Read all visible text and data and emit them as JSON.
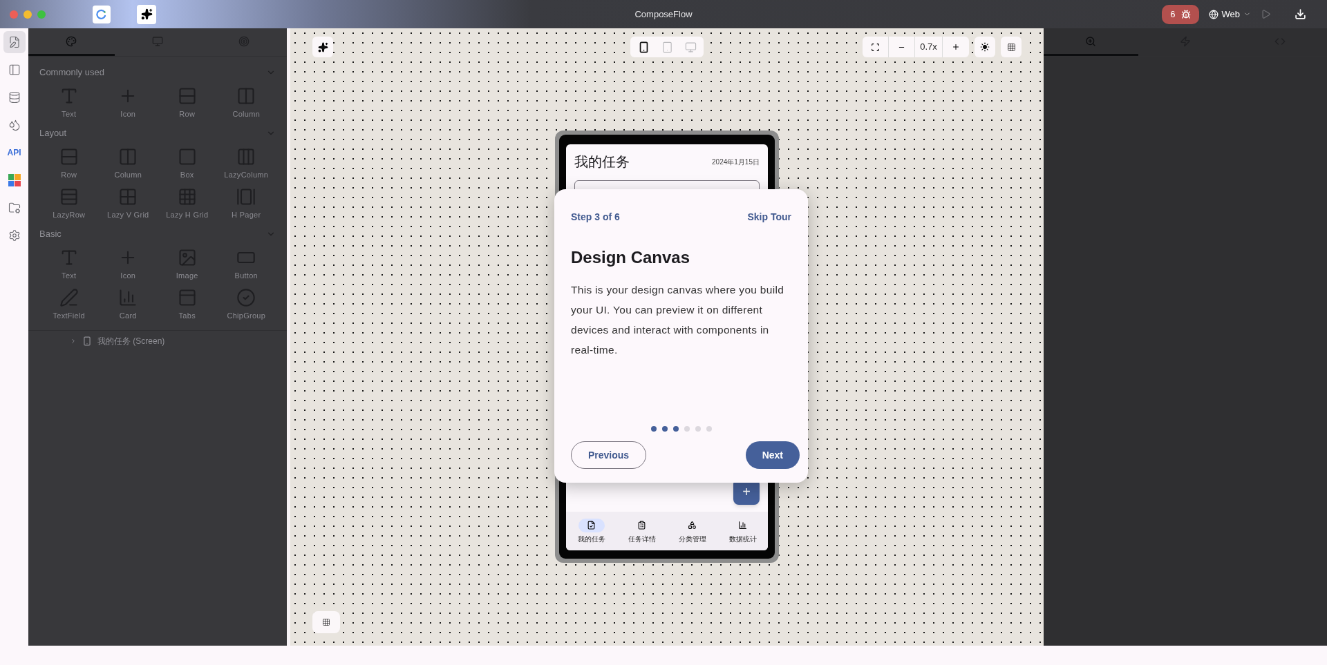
{
  "window": {
    "title": "ComposeFlow"
  },
  "title_bar": {
    "issues_count": "6",
    "target": "Web",
    "run_disabled": true
  },
  "rail": {
    "items": [
      {
        "kind": "files",
        "selected": true
      },
      {
        "kind": "panel",
        "selected": false
      },
      {
        "kind": "database",
        "selected": false
      },
      {
        "kind": "theme",
        "selected": false
      },
      {
        "kind": "api",
        "label": "API",
        "selected": false
      },
      {
        "kind": "apps",
        "selected": false
      },
      {
        "kind": "assets",
        "selected": false
      },
      {
        "kind": "settings",
        "selected": false
      }
    ]
  },
  "left_panel": {
    "tabs": [
      {
        "kind": "palette",
        "selected": true
      },
      {
        "kind": "device",
        "selected": false
      },
      {
        "kind": "target",
        "selected": false
      }
    ],
    "sections": [
      {
        "title": "Commonly used",
        "expanded": true,
        "items": [
          {
            "label": "Text",
            "kind": "text"
          },
          {
            "label": "Icon",
            "kind": "icon"
          },
          {
            "label": "Row",
            "kind": "row"
          },
          {
            "label": "Column",
            "kind": "column"
          }
        ]
      },
      {
        "title": "Layout",
        "expanded": true,
        "items": [
          {
            "label": "Row",
            "kind": "row"
          },
          {
            "label": "Column",
            "kind": "column"
          },
          {
            "label": "Box",
            "kind": "box"
          },
          {
            "label": "LazyColumn",
            "kind": "lazycolumn"
          },
          {
            "label": "LazyRow",
            "kind": "lazyrow"
          },
          {
            "label": "Lazy V Grid",
            "kind": "vgrid"
          },
          {
            "label": "Lazy H Grid",
            "kind": "hgrid"
          },
          {
            "label": "H Pager",
            "kind": "pager"
          }
        ]
      },
      {
        "title": "Basic",
        "expanded": true,
        "items": [
          {
            "label": "Text",
            "kind": "text"
          },
          {
            "label": "Icon",
            "kind": "icon"
          },
          {
            "label": "Image",
            "kind": "image"
          },
          {
            "label": "Button",
            "kind": "button"
          },
          {
            "label": "TextField",
            "kind": "textfield"
          },
          {
            "label": "Card",
            "kind": "card"
          },
          {
            "label": "Tabs",
            "kind": "tabs"
          },
          {
            "label": "ChipGroup",
            "kind": "chipgroup"
          }
        ]
      }
    ],
    "tree": [
      {
        "label": "我的任务 (Screen)",
        "expanded": false
      }
    ]
  },
  "canvas": {
    "devices": [
      {
        "kind": "phone",
        "selected": true
      },
      {
        "kind": "tablet",
        "selected": false
      },
      {
        "kind": "desktop",
        "selected": false
      }
    ],
    "zoom": "0.7x",
    "phone": {
      "title": "我的任务",
      "date": "2024年1月15日",
      "fab": "+",
      "nav": [
        {
          "label": "我的任务",
          "kind": "tasks",
          "selected": true
        },
        {
          "label": "任务详情",
          "kind": "details",
          "selected": false
        },
        {
          "label": "分类管理",
          "kind": "categories",
          "selected": false
        },
        {
          "label": "数据统计",
          "kind": "stats",
          "selected": false
        }
      ]
    }
  },
  "tour": {
    "step": "Step 3 of 6",
    "skip": "Skip Tour",
    "title": "Design Canvas",
    "body": "This is your design canvas where you build your UI. You can preview it on different devices and interact with components in real-time.",
    "dots": [
      {
        "selected": true
      },
      {
        "selected": true
      },
      {
        "selected": true
      },
      {
        "selected": false
      },
      {
        "selected": false
      },
      {
        "selected": false
      }
    ],
    "buttons": [
      {
        "label": "Previous",
        "kind": "secondary"
      },
      {
        "label": "Next",
        "kind": "primary"
      }
    ]
  },
  "right_panel": {
    "tabs": [
      {
        "kind": "inspector",
        "selected": true
      },
      {
        "kind": "actions",
        "selected": false
      },
      {
        "kind": "code",
        "selected": false
      }
    ]
  }
}
